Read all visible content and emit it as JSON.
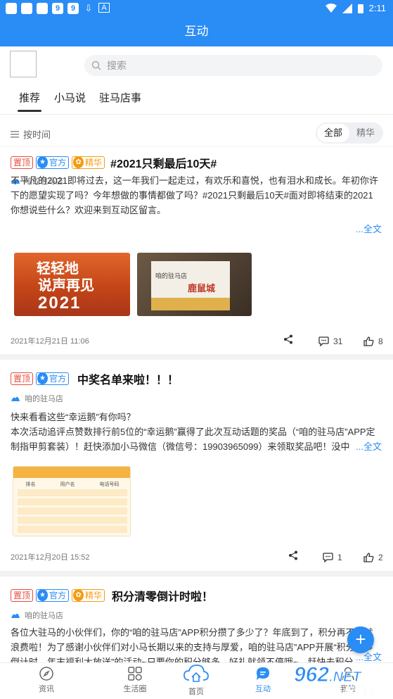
{
  "status_bar": {
    "left_icons": [
      "9",
      "9"
    ],
    "time": "2:11"
  },
  "header": {
    "title": "互动"
  },
  "search": {
    "placeholder": "搜索"
  },
  "tabs": [
    {
      "label": "推荐",
      "active": true
    },
    {
      "label": "小马说",
      "active": false
    },
    {
      "label": "驻马店事",
      "active": false
    }
  ],
  "filter": {
    "sort_label": "按时间",
    "segments": [
      {
        "label": "全部",
        "active": true
      },
      {
        "label": "精华",
        "active": false
      }
    ]
  },
  "badges": {
    "top": "置顶",
    "official": "官方",
    "essence": "精华"
  },
  "posts": [
    {
      "title": "#2021只剩最后10天#",
      "author": "咱的驻马店",
      "body": "不平凡的2021即将过去，这一年我们一起走过，有欢乐和喜悦，也有泪水和成长。年初你许下的愿望实现了吗？今年想做的事情都做了吗？#2021只剩最后10天#面对即将结束的2021你想说些什么？欢迎来到互动区留言。",
      "more": "...全文",
      "image1_text_top": "轻轻地",
      "image1_text_mid": "说声再见",
      "image1_text_year": "2021",
      "image2_text": "咱的驻马店",
      "image2_text2": "鹿鼠城",
      "date": "2021年12月21日 11:06",
      "comments": "31",
      "likes": "8"
    },
    {
      "title": "中奖名单来啦！！！",
      "author": "咱的驻马店",
      "body_line1": "快来看看这些“幸运鹅”有你吗？",
      "body": " 本次活动追评点赞数排行前5位的“幸运鹅”赢得了此次互动话题的奖品（“咱的驻马店”APP定制指甲剪套装）！赶快添加小马微信（微信号：19903965099）来领取奖品吧！没中",
      "more": "...全文",
      "table_header": [
        "排名",
        "用户名",
        "电话号码"
      ],
      "date": "2021年12月20日 15:52",
      "comments": "1",
      "likes": "2"
    },
    {
      "title": "积分清零倒计时啦！",
      "author": "咱的驻马店",
      "body": "各位大驻马的小伙伴们，你的“咱的驻马店”APP积分攒了多少了？年底到了，积分再不用就浪费啦！为了感谢小伙伴们对小马长期以来的支持与厚爱，咱的驻马店”APP开展“积分清零倒计时，年末福利大放送”的活动~只要你的积分够多，好礼就领不停哦~，赶快去积分",
      "more": "...全文"
    }
  ],
  "bottom_nav": [
    {
      "label": "资讯",
      "active": false
    },
    {
      "label": "生活圈",
      "active": false
    },
    {
      "label": "首页",
      "active": false
    },
    {
      "label": "互动",
      "active": true
    },
    {
      "label": "我的",
      "active": false
    }
  ],
  "watermark": {
    "brand": "962",
    "suffix": ".NET",
    "sub": "乐游网"
  },
  "colors": {
    "primary": "#2a8cf5",
    "top_badge": "#e74c3c",
    "essence_badge": "#f39c12"
  }
}
